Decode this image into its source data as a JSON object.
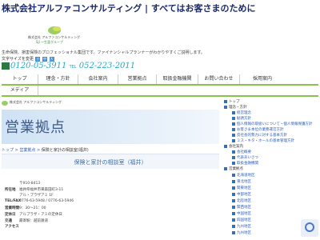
{
  "header": {
    "title": "株式会社アルファコンサルティング | すべてはお客さまのために",
    "logo_line1": "株式会社 アルファコンサルティング",
    "logo_line2": "Sjl 一生涯グループ",
    "intro": "生命保険、損害保険のプロフェッショナル集団です。ファイナンシャルプランナーがわかりやすくご説明します。"
  },
  "font_size": {
    "label": "文字サイズを変更",
    "small": "小",
    "medium": "中",
    "large": "大"
  },
  "phone": {
    "toll_free": "0120-05-3911",
    "tel_label": "TEL",
    "tel": "052-223-2011"
  },
  "nav": {
    "items": [
      "トップ",
      "理念・方針",
      "会社案内",
      "営業拠点",
      "取扱金融機関",
      "お問い合わせ",
      "採用案内",
      "メディア"
    ]
  },
  "sub_logo": "株式会社 アルファコンサルティング",
  "banner": {
    "title": "営業拠点"
  },
  "breadcrumb": {
    "items": [
      "トップ",
      "営業拠点",
      "保険と家計の相談室(福井)"
    ]
  },
  "office": {
    "name": "保険と家計の相談室（福井）"
  },
  "details": [
    {
      "label": "",
      "value": "〒910-8413"
    },
    {
      "label": "所在地",
      "value": "福井県福井市東森田町3-11"
    },
    {
      "label": "",
      "value": "アル・プラザアミ 1F"
    },
    {
      "label": "TEL/FAX",
      "value": "0776-63-5948 / 0776-63-5946"
    },
    {
      "label": "営業時間",
      "value": "9：30～21：00"
    },
    {
      "label": "定休日",
      "value": "アルプラザ・アミの定休日"
    },
    {
      "label": "交通",
      "value": "最寄駅：越前鉄道"
    },
    {
      "label": "アクセス",
      "value": ""
    }
  ],
  "sidebar": {
    "items": [
      {
        "text": "トップ",
        "level": 0
      },
      {
        "text": "理念・方針",
        "level": 0
      },
      {
        "text": "経営理念",
        "level": 1
      },
      {
        "text": "勧誘方針",
        "level": 1
      },
      {
        "text": "個人情報の取扱いについて・個人情報保護方針",
        "level": 1
      },
      {
        "text": "お客さま本位の業務運営方針",
        "level": 1
      },
      {
        "text": "反社会的勢力に対する基本方針",
        "level": 1
      },
      {
        "text": "ミス・キタ・ホールの基本管理方針",
        "level": 1
      },
      {
        "text": "会社案内",
        "level": 0
      },
      {
        "text": "会社概要",
        "level": 1
      },
      {
        "text": "代表あいさつ",
        "level": 1
      },
      {
        "text": "取扱金融機関",
        "level": 1
      },
      {
        "text": "営業拠点",
        "level": 0
      },
      {
        "text": "北海道地区",
        "level": 1
      },
      {
        "text": "東北地区",
        "level": 1
      },
      {
        "text": "関東地区",
        "level": 1
      },
      {
        "text": "中部地区",
        "level": 1
      },
      {
        "text": "北陸地区",
        "level": 1
      },
      {
        "text": "関西地区",
        "level": 1
      },
      {
        "text": "中国地区",
        "level": 1
      },
      {
        "text": "四国地区",
        "level": 1
      },
      {
        "text": "九州地区",
        "level": 1
      },
      {
        "text": "九州地区",
        "level": 1
      }
    ]
  },
  "colors": {
    "accent": "#8bc34a",
    "link": "#2a5bb8",
    "title": "#1a2a6c",
    "phone": "#2aa7c6"
  }
}
